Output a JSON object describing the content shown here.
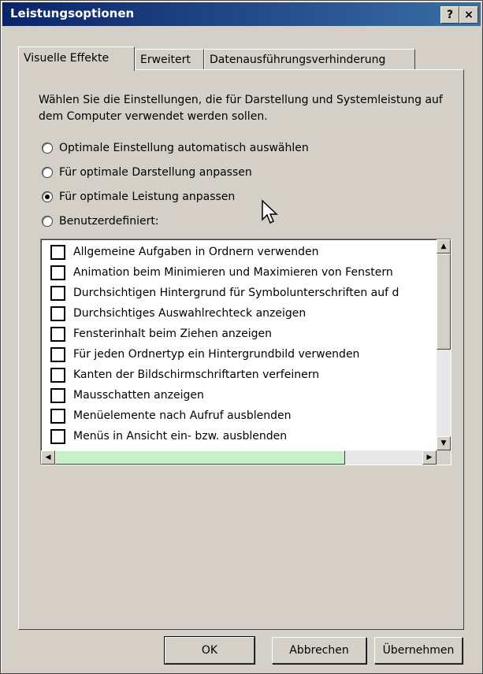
{
  "window": {
    "title": "Leistungsoptionen",
    "help_label": "?",
    "close_label": "×"
  },
  "tabs": [
    {
      "label": "Visuelle Effekte",
      "active": true
    },
    {
      "label": "Erweitert",
      "active": false
    },
    {
      "label": "Datenausführungsverhinderung",
      "active": false
    }
  ],
  "description": "Wählen Sie die Einstellungen, die für Darstellung und Systemleistung auf dem Computer verwendet werden sollen.",
  "radio_options": [
    {
      "label": "Optimale Einstellung automatisch auswählen",
      "selected": false
    },
    {
      "label": "Für optimale Darstellung anpassen",
      "selected": false
    },
    {
      "label": "Für optimale Leistung anpassen",
      "selected": true
    },
    {
      "label": "Benutzerdefiniert:",
      "selected": false
    }
  ],
  "effects": [
    {
      "label": "Allgemeine Aufgaben in Ordnern verwenden",
      "checked": false
    },
    {
      "label": "Animation beim Minimieren und Maximieren von Fenstern",
      "checked": false
    },
    {
      "label": "Durchsichtigen Hintergrund für Symbolunterschriften auf d",
      "checked": false
    },
    {
      "label": "Durchsichtiges Auswahlrechteck anzeigen",
      "checked": false
    },
    {
      "label": "Fensterinhalt beim Ziehen anzeigen",
      "checked": false
    },
    {
      "label": "Für jeden Ordnertyp ein Hintergrundbild verwenden",
      "checked": false
    },
    {
      "label": "Kanten der Bildschirmschriftarten verfeinern",
      "checked": false
    },
    {
      "label": "Mausschatten anzeigen",
      "checked": false
    },
    {
      "label": "Menüelemente nach Aufruf ausblenden",
      "checked": false
    },
    {
      "label": "Menüs in Ansicht ein- bzw. ausblenden",
      "checked": false
    }
  ],
  "buttons": {
    "ok": "OK",
    "cancel": "Abbrechen",
    "apply": "Übernehmen"
  },
  "colors": {
    "titlebar_start": "#0a246a",
    "titlebar_end": "#3a6ea5",
    "face": "#d4d0c8",
    "scroll_thumb_h": "#c8f0c8"
  }
}
